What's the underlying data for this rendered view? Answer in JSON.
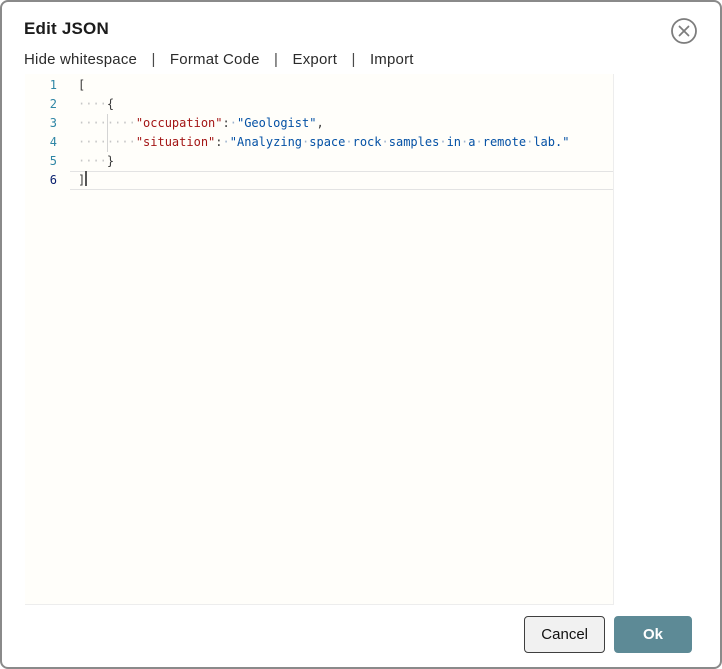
{
  "dialog": {
    "title": "Edit JSON"
  },
  "icons": {
    "close": "circle-x"
  },
  "toolbar": {
    "separator": "|",
    "items": [
      "Hide whitespace",
      "Format Code",
      "Export",
      "Import"
    ]
  },
  "editor": {
    "whitespace_dot": "·",
    "lines": [
      {
        "num": "1",
        "segments": [
          {
            "t": "punct",
            "s": "["
          }
        ]
      },
      {
        "num": "2",
        "segments": [
          {
            "t": "ws",
            "s": "····"
          },
          {
            "t": "punct",
            "s": "{"
          }
        ]
      },
      {
        "num": "3",
        "segments": [
          {
            "t": "ws",
            "s": "····"
          },
          {
            "t": "guide",
            "s": ""
          },
          {
            "t": "ws",
            "s": "····"
          },
          {
            "t": "key",
            "s": "\"occupation\""
          },
          {
            "t": "punct",
            "s": ":"
          },
          {
            "t": "wss",
            "s": "·"
          },
          {
            "t": "str",
            "s": "\"Geologist\""
          },
          {
            "t": "punct",
            "s": ","
          }
        ]
      },
      {
        "num": "4",
        "segments": [
          {
            "t": "ws",
            "s": "····"
          },
          {
            "t": "guide",
            "s": ""
          },
          {
            "t": "ws",
            "s": "····"
          },
          {
            "t": "key",
            "s": "\"situation\""
          },
          {
            "t": "punct",
            "s": ":"
          },
          {
            "t": "wss",
            "s": "·"
          },
          {
            "t": "str",
            "s": "\"Analyzing"
          },
          {
            "t": "wss",
            "s": "·"
          },
          {
            "t": "str",
            "s": "space"
          },
          {
            "t": "wss",
            "s": "·"
          },
          {
            "t": "str",
            "s": "rock"
          },
          {
            "t": "wss",
            "s": "·"
          },
          {
            "t": "str",
            "s": "samples"
          },
          {
            "t": "wss",
            "s": "·"
          },
          {
            "t": "str",
            "s": "in"
          },
          {
            "t": "wss",
            "s": "·"
          },
          {
            "t": "str",
            "s": "a"
          },
          {
            "t": "wss",
            "s": "·"
          },
          {
            "t": "str",
            "s": "remote"
          },
          {
            "t": "wss",
            "s": "·"
          },
          {
            "t": "str",
            "s": "lab.\""
          }
        ]
      },
      {
        "num": "5",
        "segments": [
          {
            "t": "ws",
            "s": "····"
          },
          {
            "t": "punct",
            "s": "}"
          }
        ]
      },
      {
        "num": "6",
        "active": true,
        "cursor": true,
        "segments": [
          {
            "t": "punct",
            "s": "]"
          }
        ]
      }
    ]
  },
  "footer": {
    "cancel_label": "Cancel",
    "ok_label": "Ok"
  },
  "colors": {
    "accent": "#5d8a96",
    "json_key": "#a31515",
    "json_string": "#0451a5",
    "line_number": "#2f86a5",
    "active_line_number": "#0b216f"
  }
}
